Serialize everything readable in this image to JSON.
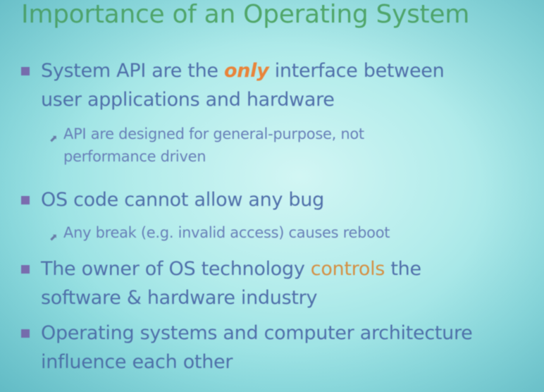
{
  "title": "Importance of an Operating System",
  "bullets": [
    {
      "parts": [
        "System API are the ",
        "only",
        " interface between user applications and hardware"
      ],
      "line1_pre": "System API are the ",
      "line1_em": "only",
      "line1_post": " interface between",
      "line2": "user applications and hardware",
      "sub": {
        "line1": "API are designed for general-purpose, not",
        "line2": "performance driven"
      }
    },
    {
      "line1": "OS code cannot allow any bug",
      "sub": {
        "line1": "Any break (e.g. invalid access) causes reboot"
      }
    },
    {
      "line1_pre": "The owner of OS technology ",
      "line1_em": "controls",
      "line1_post": " the",
      "line2": "software & hardware industry"
    },
    {
      "line1": "Operating systems and computer architecture",
      "line2": "influence each other"
    }
  ],
  "icons": {
    "bullet": "square-bullet-icon",
    "sub_bullet": "arrow-bullet-icon"
  },
  "colors": {
    "title": "#52a868",
    "bullet_text": "#5070aa",
    "bullet_marker": "#7e6bb0",
    "emphasis_only": "#e8843a",
    "emphasis_controls": "#d49044",
    "background": "#b3eceb"
  }
}
